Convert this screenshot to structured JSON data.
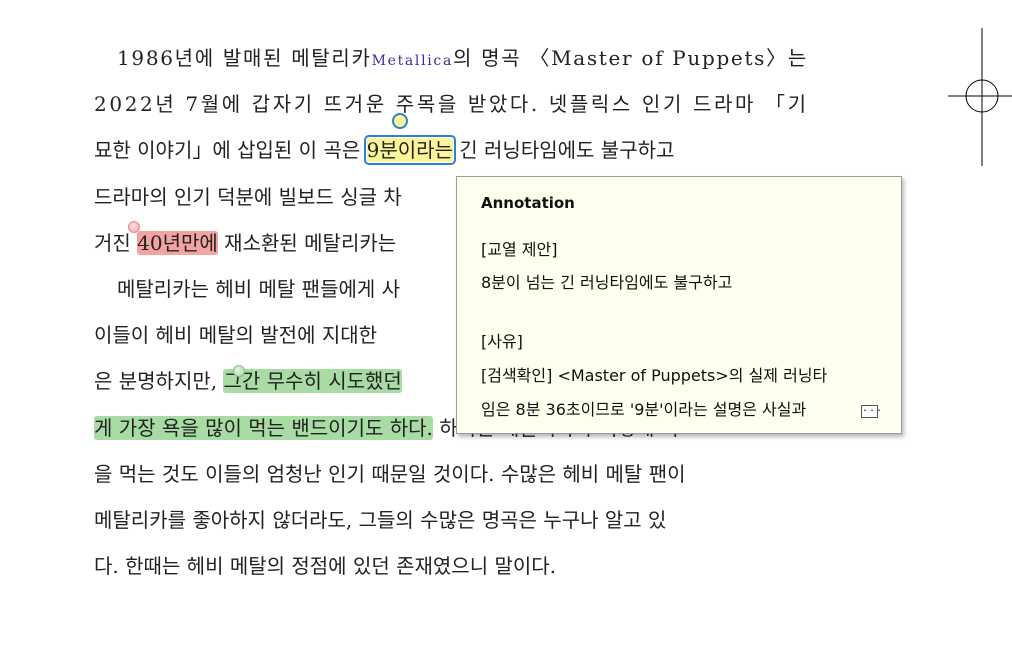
{
  "document": {
    "lines": [
      {
        "indent": true,
        "segments": [
          {
            "text": "1986년에 발매된 메탈리카"
          },
          {
            "text": "Metallica",
            "style": "latin-small"
          },
          {
            "text": "의 명곡 〈Master of Puppets〉는"
          }
        ]
      },
      {
        "segments": [
          {
            "text": "2022년 7월에 갑자기 뜨거운 주목을 받았다. 넷플릭스 인기 드라마 「기"
          }
        ]
      },
      {
        "segments": [
          {
            "text": "묘한 이야기」에 삽입된 이 곡은 "
          },
          {
            "text": "9분이라는",
            "style": "hl-yellow-sel"
          },
          {
            "text": " 긴 러닝타임에도 불구하고"
          }
        ]
      },
      {
        "segments": [
          {
            "text": "드라마의 인기 덕분에 빌보드 싱글 차"
          }
        ]
      },
      {
        "segments": [
          {
            "text": "거진 "
          },
          {
            "text": "40년만에",
            "style": "hl-red"
          },
          {
            "text": " 재소환된 메탈리카는"
          }
        ]
      },
      {
        "indent": true,
        "segments": [
          {
            "text": "메탈리카는 헤비 메탈 팬들에게 사"
          }
        ]
      },
      {
        "segments": [
          {
            "text": "이들이 헤비 메탈의 발전에 지대한"
          }
        ]
      },
      {
        "segments": [
          {
            "text": "은 분명하지만, "
          },
          {
            "text": "그간 무수히 시도했던",
            "style": "hl-green"
          }
        ]
      },
      {
        "segments": [
          {
            "text": "게 가장 욕을 많이 먹는 밴드이기도 하다.",
            "style": "hl-green"
          },
          {
            "text": " 하지만 메탈리카가 이렇게 욕"
          }
        ]
      },
      {
        "segments": [
          {
            "text": "을 먹는 것도 이들의 엄청난 인기 때문일 것이다. 수많은 헤비 메탈 팬이"
          }
        ]
      },
      {
        "segments": [
          {
            "text": "메탈리카를 좋아하지 않더라도, 그들의 수많은 명곡은 누구나 알고 있"
          }
        ]
      },
      {
        "segments": [
          {
            "text": "다. 한때는 헤비 메탈의 정점에 있던 존재였으니 말이다."
          }
        ]
      }
    ]
  },
  "annotation_popup": {
    "title": "Annotation",
    "lines": [
      "[교열 제안]",
      "8분이 넘는 긴 러닝타임에도 불구하고",
      "",
      "[사유]",
      "[검색확인] <Master of Puppets>의 실제 러닝타",
      "임은 8분 36초이므로 '9분'이라는 설명은 사실과"
    ],
    "more_icon": "ellipsis-icon"
  },
  "colors": {
    "highlight_yellow": "#fbf59a",
    "highlight_red": "#f4a3a3",
    "highlight_green": "#a9dba4",
    "selection_border": "#2f7fd6",
    "popup_background": "#fffff0"
  }
}
